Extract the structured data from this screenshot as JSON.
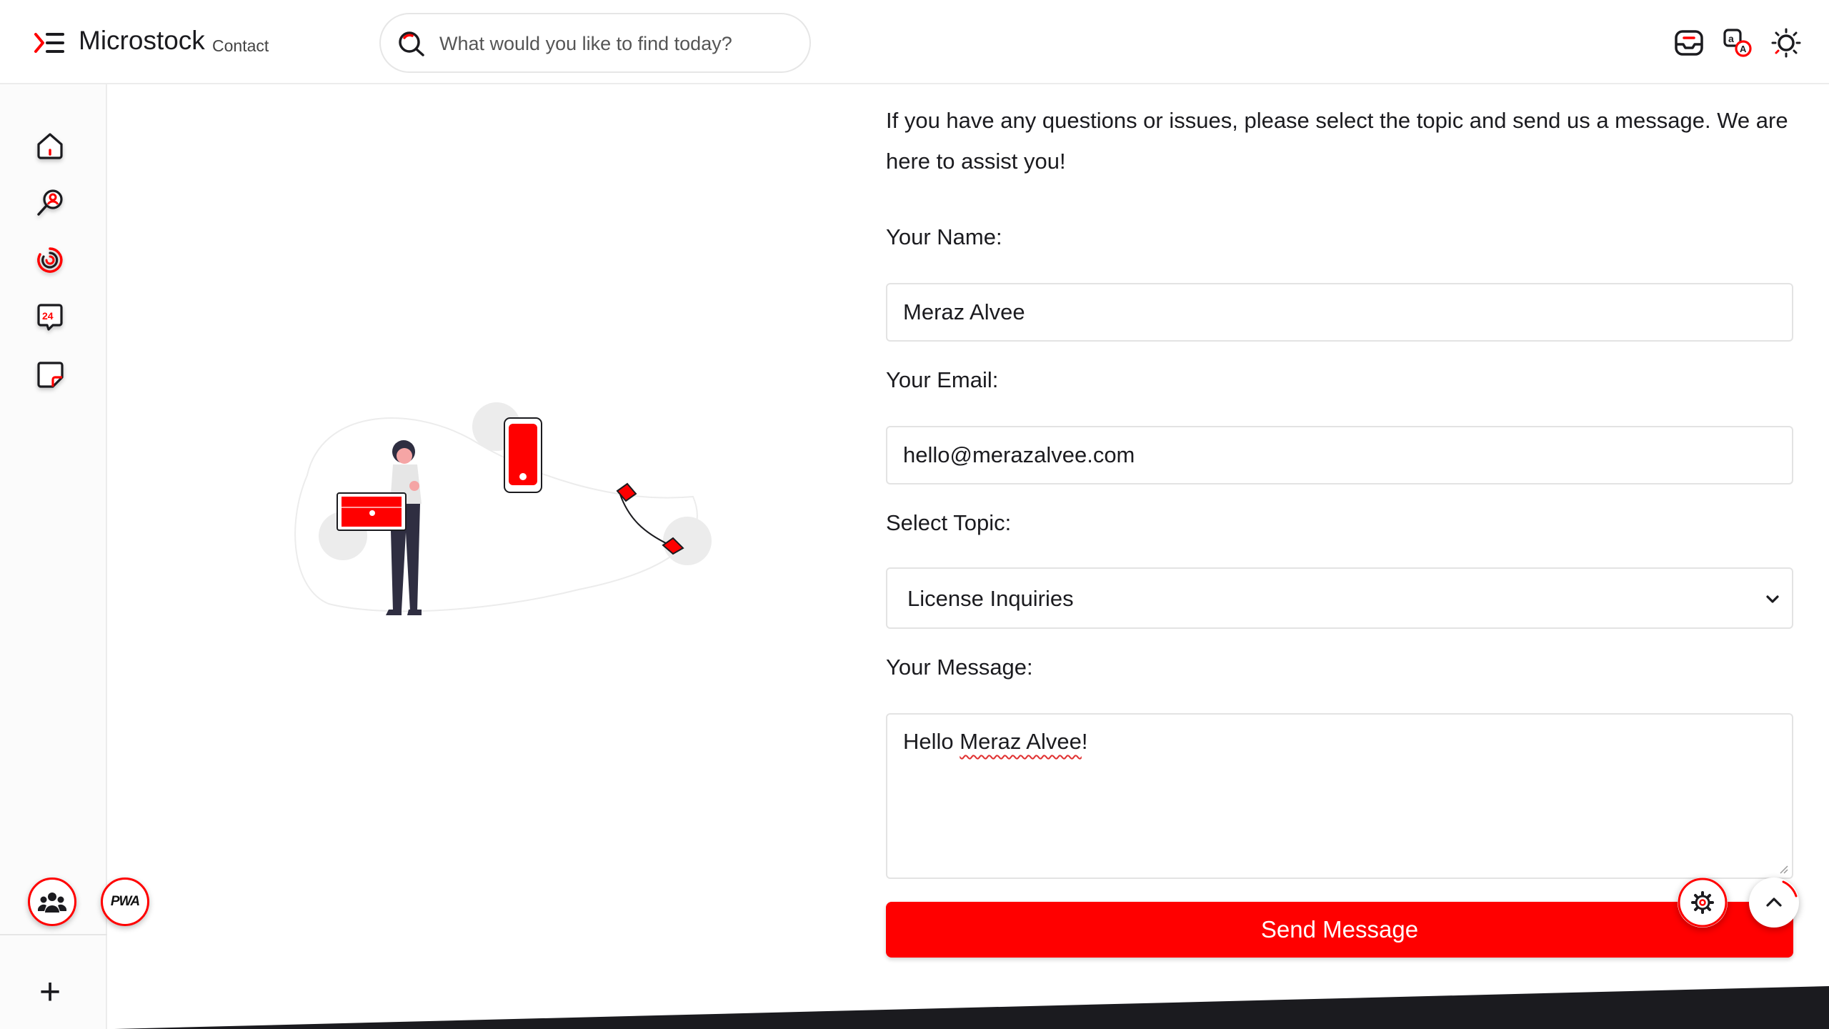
{
  "header": {
    "brand": "Microstock",
    "page_label": "Contact",
    "search_placeholder": "What would you like to find today?",
    "icons": [
      "inbox-icon",
      "translate-icon",
      "sun-icon"
    ]
  },
  "sidebar": {
    "items": [
      {
        "name": "home-icon"
      },
      {
        "name": "search-person-icon"
      },
      {
        "name": "loading-spiral-icon"
      },
      {
        "name": "support-24-icon"
      },
      {
        "name": "sticky-note-icon"
      }
    ],
    "add_button": "+"
  },
  "floating": {
    "community_button": "community-icon",
    "pwa_label": "PWA"
  },
  "contact": {
    "intro": "If you have any questions or issues, please select the topic and send us a message. We are here to assist you!",
    "name_label": "Your Name:",
    "name_value": "Meraz Alvee",
    "email_label": "Your Email:",
    "email_value": "hello@merazalvee.com",
    "topic_label": "Select Topic:",
    "topic_value": "License Inquiries",
    "message_label": "Your Message:",
    "message_greeting": "Hello ",
    "message_name": "Meraz Alvee",
    "message_punct": "!",
    "send_label": "Send Message"
  },
  "colors": {
    "accent": "#ff0000",
    "text": "#1b1b1f",
    "border": "#e3e3e3",
    "footer": "#1b1b1f"
  }
}
